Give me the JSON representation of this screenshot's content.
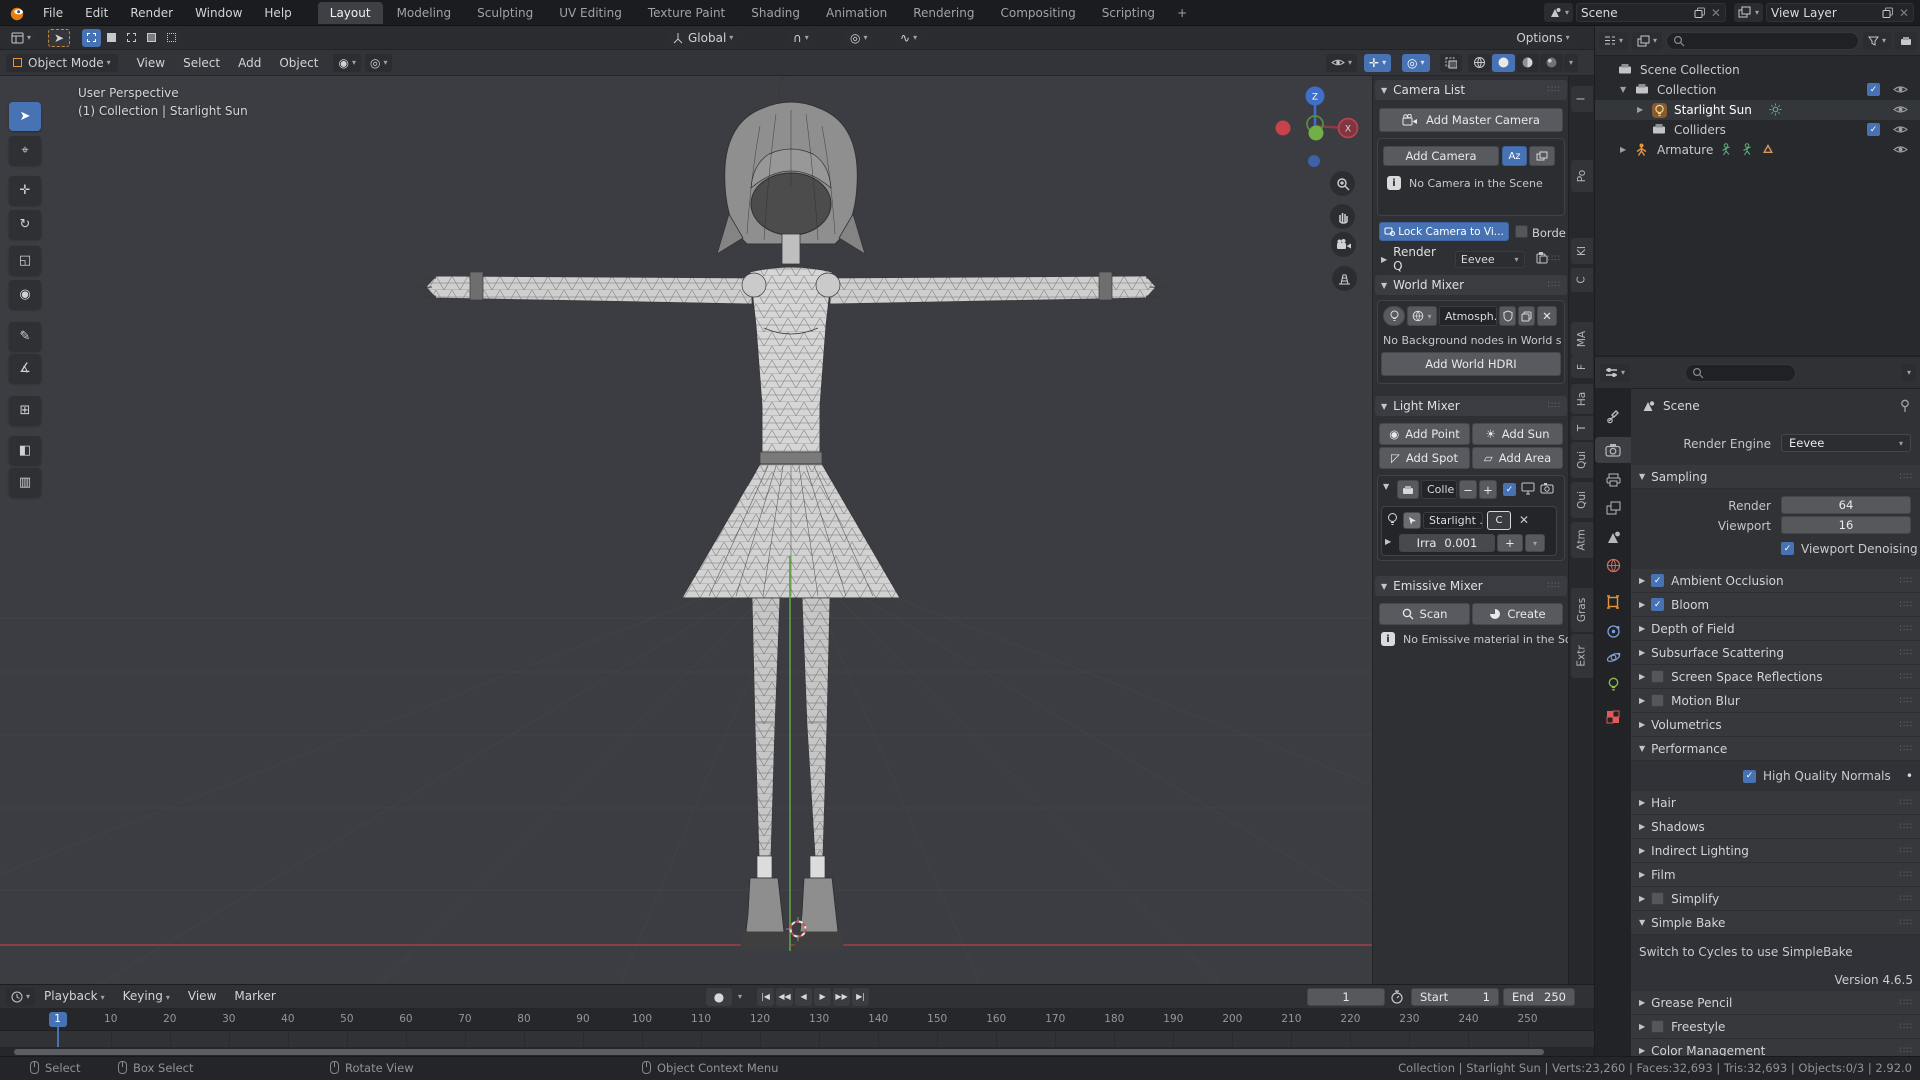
{
  "topbar": {
    "menus": [
      "File",
      "Edit",
      "Render",
      "Window",
      "Help"
    ],
    "workspaces": [
      "Layout",
      "Modeling",
      "Sculpting",
      "UV Editing",
      "Texture Paint",
      "Shading",
      "Animation",
      "Rendering",
      "Compositing",
      "Scripting"
    ],
    "active_workspace": "Layout",
    "new_workspace_label": "+",
    "scene_label": "Scene",
    "view_layer_label": "View Layer"
  },
  "viewport": {
    "header": {
      "mode": "Object Mode",
      "menus": [
        "View",
        "Select",
        "Add",
        "Object"
      ],
      "orientation": "Global",
      "options_label": "Options"
    },
    "overlay": {
      "line1": "User Perspective",
      "line2": "(1) Collection | Starlight Sun"
    },
    "gizmo": {
      "z_label": "Z",
      "x_label": "X"
    },
    "tools": [
      {
        "name": "select-box",
        "glyph": "➤",
        "active": true
      },
      {
        "name": "cursor",
        "glyph": "⌖"
      },
      {
        "name": "move",
        "glyph": "✛"
      },
      {
        "name": "rotate",
        "glyph": "↻"
      },
      {
        "name": "scale",
        "glyph": "◱"
      },
      {
        "name": "transform",
        "glyph": "◉"
      },
      {
        "name": "annotate",
        "glyph": "✎"
      },
      {
        "name": "measure",
        "glyph": "∡"
      },
      {
        "name": "add-cube",
        "glyph": "⊞"
      },
      {
        "name": "extrude",
        "glyph": "◧"
      },
      {
        "name": "mesh-tool",
        "glyph": "▥"
      }
    ]
  },
  "n_panel": {
    "tabs": [
      "I",
      "Po",
      "KI",
      "C",
      "MA",
      "F",
      "Ha",
      "T",
      "Qui",
      "Qui",
      "Atm",
      "Gras",
      "Extr"
    ],
    "camera_list": {
      "title": "Camera List",
      "add_master": "Add Master Camera",
      "add_camera": "Add Camera",
      "az_label": "Az",
      "info": "No Camera in the Scene",
      "lock_label": "Lock Camera to Vi...",
      "border_label": "Borde"
    },
    "render_q": {
      "title": "Render Q",
      "engine": "Eevee"
    },
    "world_mixer": {
      "title": "World Mixer",
      "world_name": "Atmosph...",
      "info": "No Background nodes in World sh...",
      "add_hdri": "Add World HDRI"
    },
    "light_mixer": {
      "title": "Light Mixer",
      "add_point": "Add Point",
      "add_sun": "Add Sun",
      "add_spot": "Add Spot",
      "add_area": "Add Area",
      "collection_name": "Colle",
      "minus": "−",
      "plus": "+",
      "light_name": "Starlight ...",
      "c_button": "C",
      "irradiance_label": "Irra",
      "irradiance_value": "0.001"
    },
    "emissive_mixer": {
      "title": "Emissive Mixer",
      "scan": "Scan",
      "create": "Create",
      "info": "No Emissive material in the Sc..."
    }
  },
  "outliner": {
    "rows": [
      {
        "label": "Scene Collection",
        "icon": "collection",
        "indent": 0
      },
      {
        "label": "Collection",
        "icon": "collection",
        "indent": 1,
        "expand": "open",
        "check": true,
        "eye": true
      },
      {
        "label": "Starlight Sun",
        "icon": "light",
        "indent": 2,
        "expand": "closed",
        "selected": true,
        "badges": [
          "sun"
        ],
        "eye": true
      },
      {
        "label": "Colliders",
        "icon": "collection",
        "indent": 2,
        "check": true,
        "eye": true
      },
      {
        "label": "Armature",
        "icon": "armature",
        "indent": 1,
        "expand": "closed",
        "badges": [
          "person",
          "person",
          "tri"
        ],
        "eye": true
      }
    ]
  },
  "properties": {
    "breadcrumb": "Scene",
    "render_engine_label": "Render Engine",
    "render_engine": "Eevee",
    "sampling": {
      "title": "Sampling",
      "render_label": "Render",
      "render_value": "64",
      "viewport_label": "Viewport",
      "viewport_value": "16",
      "denoise_label": "Viewport Denoising"
    },
    "tabs": [
      {
        "name": "tool"
      },
      {
        "name": "render",
        "active": true
      },
      {
        "name": "output"
      },
      {
        "name": "view-layer"
      },
      {
        "name": "scene"
      },
      {
        "name": "world"
      },
      {
        "name": "object"
      },
      {
        "name": "constraints"
      },
      {
        "name": "physics"
      },
      {
        "name": "data"
      },
      {
        "name": "texture"
      }
    ],
    "rows": [
      {
        "kind": "sec",
        "label": "Ambient Occlusion",
        "cb": "on"
      },
      {
        "kind": "sec",
        "label": "Bloom",
        "cb": "on"
      },
      {
        "kind": "sec",
        "label": "Depth of Field"
      },
      {
        "kind": "sec",
        "label": "Subsurface Scattering"
      },
      {
        "kind": "sec",
        "label": "Screen Space Reflections",
        "cb": "off"
      },
      {
        "kind": "sec",
        "label": "Motion Blur",
        "cb": "off"
      },
      {
        "kind": "sec",
        "label": "Volumetrics"
      },
      {
        "kind": "sec",
        "label": "Performance",
        "open": true
      },
      {
        "kind": "child",
        "label": "High Quality Normals",
        "cb": "on",
        "dot": true
      },
      {
        "kind": "sec",
        "label": "Hair"
      },
      {
        "kind": "sec",
        "label": "Shadows"
      },
      {
        "kind": "sec",
        "label": "Indirect Lighting"
      },
      {
        "kind": "sec",
        "label": "Film"
      },
      {
        "kind": "sec",
        "label": "Simplify",
        "cb": "off"
      },
      {
        "kind": "sec",
        "label": "Simple Bake",
        "open": true
      },
      {
        "kind": "note",
        "label": "Switch to Cycles to use SimpleBake"
      },
      {
        "kind": "noteR",
        "label": "Version 4.6.5"
      },
      {
        "kind": "sec",
        "label": "Grease Pencil"
      },
      {
        "kind": "sec",
        "label": "Freestyle",
        "cb": "off"
      },
      {
        "kind": "sec",
        "label": "Color Management"
      }
    ]
  },
  "timeline": {
    "menus": [
      "Playback",
      "Keying",
      "View",
      "Marker"
    ],
    "record_glyph": "●",
    "transport": [
      {
        "name": "jump-to-start",
        "glyph": "|◀"
      },
      {
        "name": "prev-keyframe",
        "glyph": "◀◀"
      },
      {
        "name": "play-reverse",
        "glyph": "◀"
      },
      {
        "name": "play",
        "glyph": "▶"
      },
      {
        "name": "next-keyframe",
        "glyph": "▶▶"
      },
      {
        "name": "jump-to-end",
        "glyph": "▶|"
      }
    ],
    "current_frame": "1",
    "start_label": "Start",
    "start_value": "1",
    "end_label": "End",
    "end_value": "250",
    "first_tick": "1",
    "ticks": [
      10,
      20,
      30,
      40,
      50,
      60,
      70,
      80,
      90,
      100,
      110,
      120,
      130,
      140,
      150,
      160,
      170,
      180,
      190,
      200,
      210,
      220,
      230,
      240,
      250
    ]
  },
  "statusbar": {
    "items": [
      "Select",
      "Box Select",
      "Rotate View",
      "Object Context Menu"
    ],
    "right": "Collection | Starlight Sun | Verts:23,260 | Faces:32,693 | Tris:32,693 | Objects:0/3 | 2.92.0"
  },
  "colors": {
    "accent": "#4772b3",
    "axis_x": "#a83e46",
    "axis_y": "#5f9c41",
    "gizmo_z": "#3f6fc9",
    "gizmo_x_neg": "#c8424d",
    "object_orange": "#e8933c",
    "data_green": "#7fbf4d"
  }
}
